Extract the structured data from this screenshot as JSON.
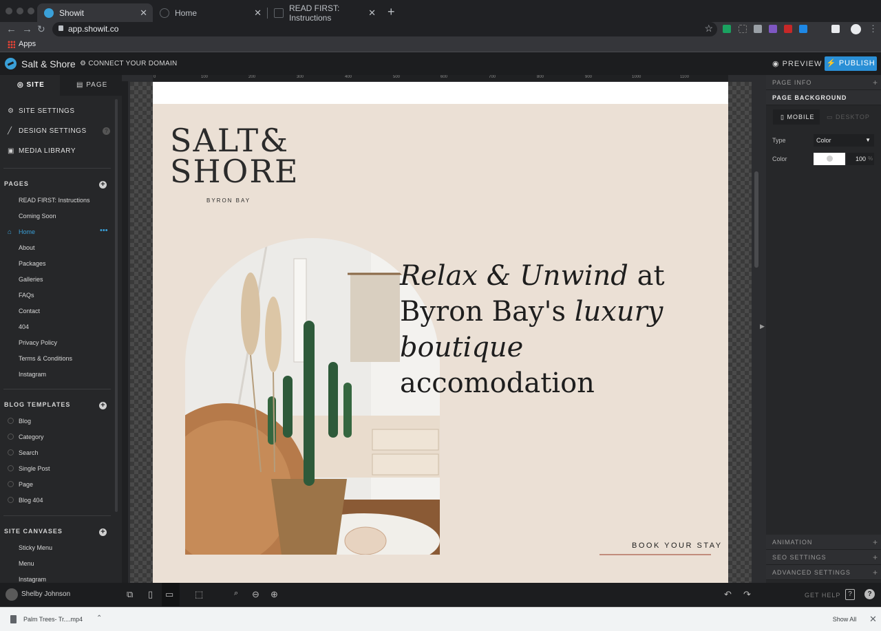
{
  "browser": {
    "tabs": [
      {
        "title": "Showit",
        "active": true
      },
      {
        "title": "Home",
        "active": false
      },
      {
        "title": "READ FIRST: Instructions",
        "active": false
      }
    ],
    "url": "app.showit.co",
    "bookmarks_apps": "Apps"
  },
  "header": {
    "site_name": "Salt & Shore",
    "connect_domain": "CONNECT YOUR DOMAIN",
    "preview": "PREVIEW",
    "publish": "PUBLISH"
  },
  "sidebar": {
    "tabs": [
      "SITE",
      "PAGE"
    ],
    "menu": [
      "SITE SETTINGS",
      "DESIGN SETTINGS",
      "MEDIA LIBRARY"
    ],
    "pages_header": "PAGES",
    "pages": [
      "READ FIRST: Instructions",
      "Coming Soon",
      "Home",
      "About",
      "Packages",
      "Galleries",
      "FAQs",
      "Contact",
      "404",
      "Privacy Policy",
      "Terms & Conditions",
      "Instagram"
    ],
    "blog_header": "BLOG TEMPLATES",
    "blog": [
      "Blog",
      "Category",
      "Search",
      "Single Post",
      "Page",
      "Blog 404"
    ],
    "canvases_header": "SITE CANVASES",
    "canvases": [
      "Sticky Menu",
      "Menu",
      "Instagram"
    ]
  },
  "ruler": [
    "0",
    "100",
    "200",
    "300",
    "400",
    "500",
    "600",
    "700",
    "800",
    "900",
    "1000",
    "1100"
  ],
  "canvas": {
    "brand_line1": "SALT&",
    "brand_line2": "SHORE",
    "brand_location": "BYRON BAY",
    "headline_italic1": "Relax & Unwind",
    "headline_plain1": " at",
    "headline_plain2": "Byron Bay's ",
    "headline_italic2": "luxury",
    "headline_italic3": "boutique",
    "headline_plain3": " accomodation",
    "cta": "BOOK YOUR STAY",
    "accent_color": "#c28c7c"
  },
  "right_panel": {
    "page_info": "PAGE INFO",
    "page_background": "PAGE BACKGROUND",
    "mobile_tab": "MOBILE",
    "desktop_tab": "DESKTOP",
    "type_label": "Type",
    "type_value": "Color",
    "color_label": "Color",
    "opacity_value": "100",
    "opacity_unit": "%",
    "animation": "ANIMATION",
    "seo": "SEO SETTINGS",
    "advanced": "ADVANCED SETTINGS"
  },
  "bottom": {
    "user": "Shelby Johnson",
    "get_help": "GET HELP",
    "help_q": "?",
    "chat": "?"
  },
  "downloads": {
    "file": "Palm Trees- Tr....mp4",
    "show_all": "Show All"
  },
  "colors": {
    "brand_blue": "#2a8fd6",
    "canvas_bg": "#ebe0d5"
  }
}
